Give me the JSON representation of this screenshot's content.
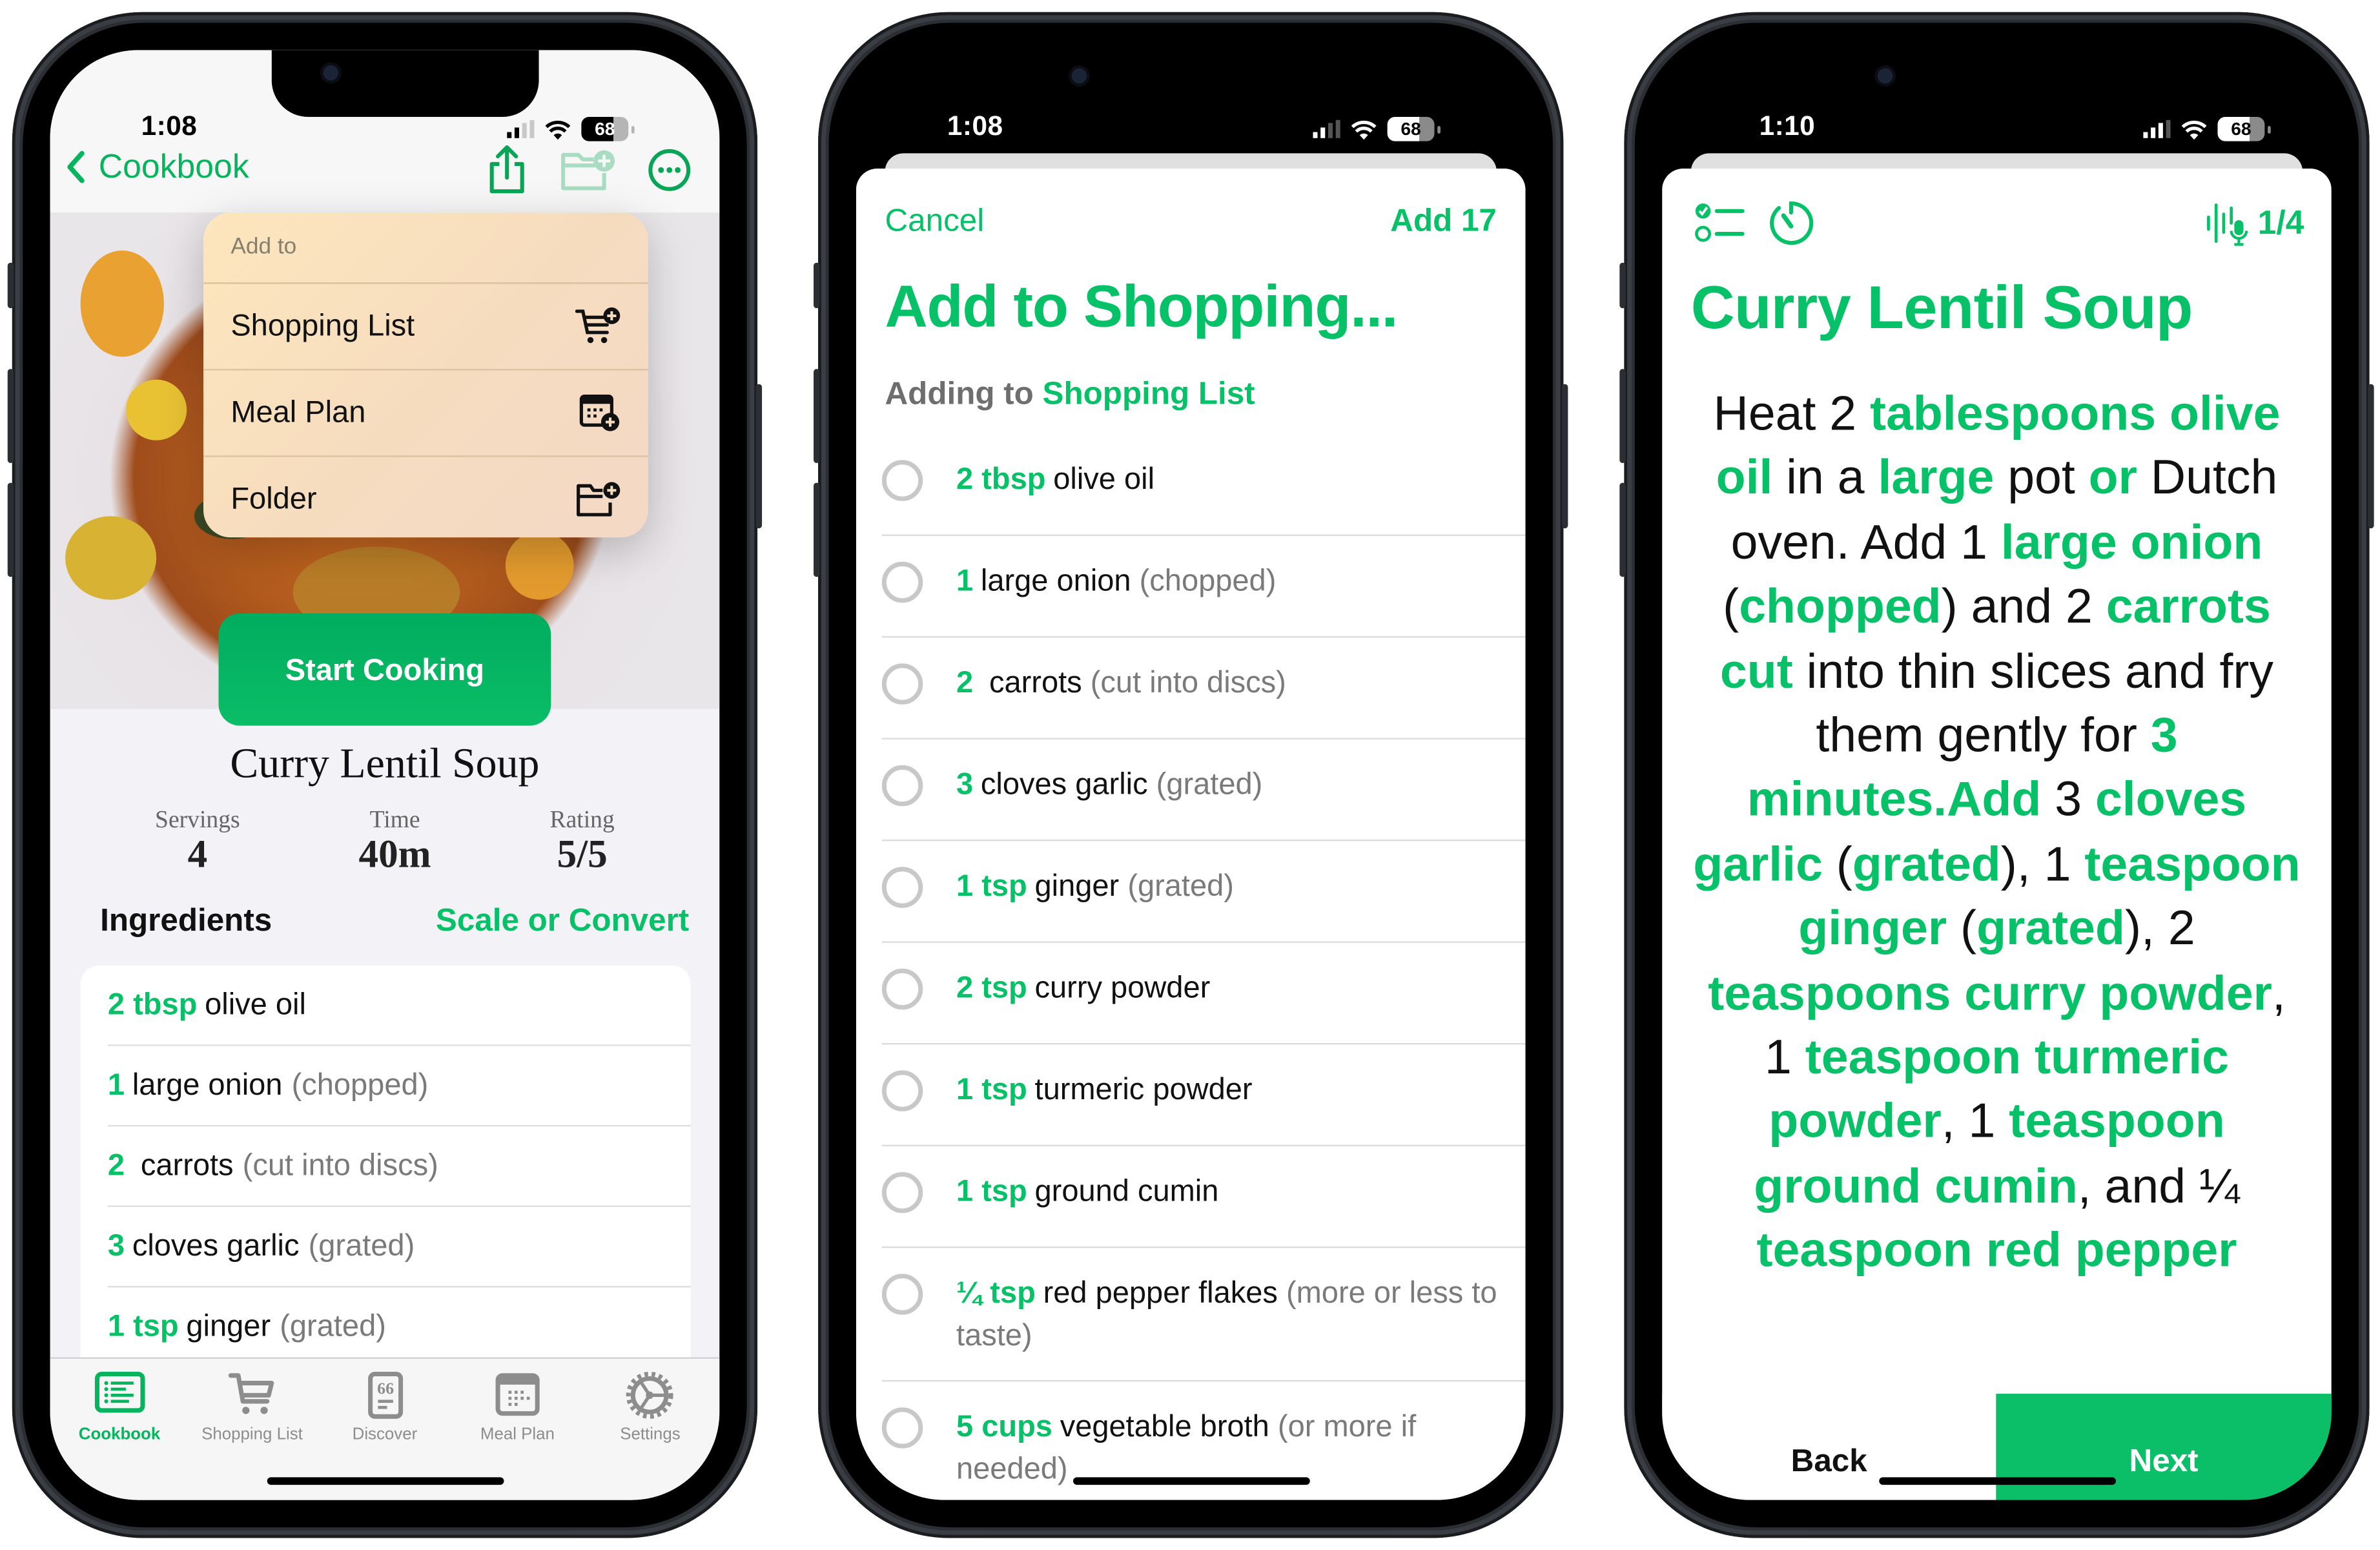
{
  "accent_color": "#07c168",
  "phones": [
    {
      "status": {
        "time": "1:08",
        "battery": "68"
      },
      "nav": {
        "back_label": "Cookbook",
        "icons": [
          "share-icon",
          "folder-plus-icon",
          "more-icon"
        ]
      },
      "menu": {
        "header": "Add to",
        "items": [
          {
            "label": "Shopping List",
            "icon": "cart-plus-icon"
          },
          {
            "label": "Meal Plan",
            "icon": "calendar-plus-icon"
          },
          {
            "label": "Folder",
            "icon": "folder-plus-icon"
          }
        ]
      },
      "start_button": "Start Cooking",
      "recipe_title": "Curry Lentil Soup",
      "stats": [
        {
          "label": "Servings",
          "value": "4"
        },
        {
          "label": "Time",
          "value": "40m"
        },
        {
          "label": "Rating",
          "value": "5/5"
        }
      ],
      "ingredients_header": "Ingredients",
      "scale_link": "Scale or Convert",
      "ingredients": [
        {
          "qty": "2 tbsp",
          "name": "olive oil",
          "note": ""
        },
        {
          "qty": "1",
          "name": "large onion",
          "note": "(chopped)"
        },
        {
          "qty": "2",
          "name": " carrots",
          "note": "(cut into discs)"
        },
        {
          "qty": "3",
          "name": "cloves garlic",
          "note": "(grated)"
        },
        {
          "qty": "1 tsp",
          "name": "ginger",
          "note": "(grated)"
        }
      ],
      "tabs": [
        {
          "label": "Cookbook",
          "icon": "cookbook-icon",
          "active": true
        },
        {
          "label": "Shopping List",
          "icon": "cart-icon",
          "active": false
        },
        {
          "label": "Discover",
          "icon": "discover-icon",
          "active": false
        },
        {
          "label": "Meal Plan",
          "icon": "calendar-icon",
          "active": false
        },
        {
          "label": "Settings",
          "icon": "gear-icon",
          "active": false
        }
      ]
    },
    {
      "status": {
        "time": "1:08",
        "battery": "68"
      },
      "cancel_label": "Cancel",
      "add_label": "Add 17",
      "title": "Add to Shopping...",
      "subtitle_prefix": "Adding to",
      "subtitle_target": "Shopping List",
      "items": [
        {
          "qty": "2 tbsp",
          "name": "olive oil",
          "note": ""
        },
        {
          "qty": "1",
          "name": "large onion",
          "note": "(chopped)"
        },
        {
          "qty": "2",
          "name": " carrots",
          "note": "(cut into discs)"
        },
        {
          "qty": "3",
          "name": "cloves garlic",
          "note": "(grated)"
        },
        {
          "qty": "1 tsp",
          "name": "ginger",
          "note": "(grated)"
        },
        {
          "qty": "2 tsp",
          "name": "curry powder",
          "note": ""
        },
        {
          "qty": "1 tsp",
          "name": "turmeric powder",
          "note": ""
        },
        {
          "qty": "1 tsp",
          "name": "ground cumin",
          "note": ""
        },
        {
          "qty": "¼ tsp",
          "name": "red pepper flakes",
          "note": "(more or less to taste)"
        },
        {
          "qty": "5 cups",
          "name": "vegetable broth",
          "note": "(or more if needed)"
        }
      ]
    },
    {
      "status": {
        "time": "1:10",
        "battery": "68"
      },
      "step_indicator": "1/4",
      "title": "Curry Lentil Soup",
      "instruction_segments": [
        {
          "t": "Heat 2 ",
          "h": false
        },
        {
          "t": "tablespoons olive oil",
          "h": true
        },
        {
          "t": " in a ",
          "h": false
        },
        {
          "t": "large",
          "h": true
        },
        {
          "t": " pot ",
          "h": false
        },
        {
          "t": "or",
          "h": true
        },
        {
          "t": " Dutch oven. Add 1 ",
          "h": false
        },
        {
          "t": "large onion",
          "h": true
        },
        {
          "t": " (",
          "h": false
        },
        {
          "t": "chopped",
          "h": true
        },
        {
          "t": ") and 2 ",
          "h": false
        },
        {
          "t": "carrots cut",
          "h": true
        },
        {
          "t": " into thin slices and fry them gently for ",
          "h": false
        },
        {
          "t": "3 minutes.Add",
          "h": true
        },
        {
          "t": " 3 ",
          "h": false
        },
        {
          "t": "cloves garlic",
          "h": true
        },
        {
          "t": " (",
          "h": false
        },
        {
          "t": "grated",
          "h": true
        },
        {
          "t": "), 1 ",
          "h": false
        },
        {
          "t": "teaspoon ginger",
          "h": true
        },
        {
          "t": " (",
          "h": false
        },
        {
          "t": "grated",
          "h": true
        },
        {
          "t": "), 2 ",
          "h": false
        },
        {
          "t": "teaspoons curry powder",
          "h": true
        },
        {
          "t": ", 1 ",
          "h": false
        },
        {
          "t": "teaspoon turmeric powder",
          "h": true
        },
        {
          "t": ", 1 ",
          "h": false
        },
        {
          "t": "teaspoon ground cumin",
          "h": true
        },
        {
          "t": ", and ¼ ",
          "h": false
        },
        {
          "t": "teaspoon red pepper",
          "h": true
        }
      ],
      "back_label": "Back",
      "next_label": "Next"
    }
  ]
}
